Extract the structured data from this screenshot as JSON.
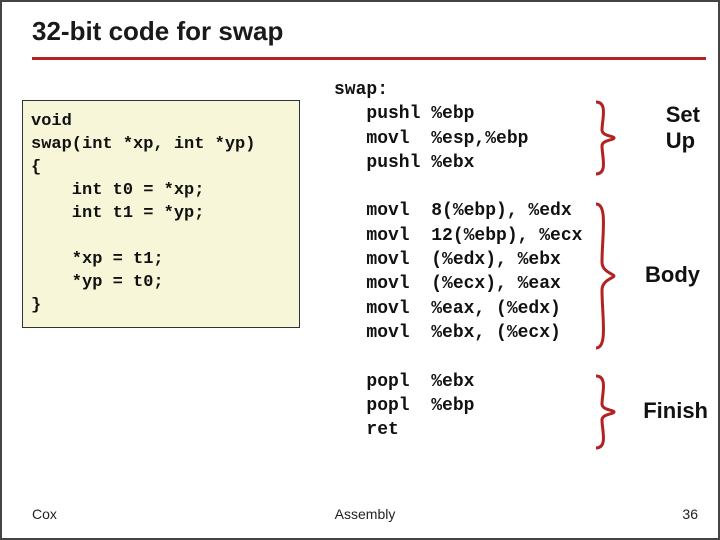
{
  "title": "32-bit code for swap",
  "c_code": "void\nswap(int *xp, int *yp)\n{\n    int t0 = *xp;\n    int t1 = *yp;\n\n    *xp = t1;\n    *yp = t0;\n}",
  "asm_block": "swap:\n   pushl %ebp\n   movl  %esp,%ebp\n   pushl %ebx\n\n   movl  8(%ebp), %edx\n   movl  12(%ebp), %ecx\n   movl  (%edx), %ebx\n   movl  (%ecx), %eax\n   movl  %eax, (%edx)\n   movl  %ebx, (%ecx)\n\n   popl  %ebx\n   popl  %ebp\n   ret",
  "annotations": {
    "setup": "Set\nUp",
    "body": "Body",
    "finish": "Finish"
  },
  "footer": {
    "left": "Cox",
    "center": "Assembly",
    "right": "36"
  },
  "chart_data": {
    "type": "table",
    "title": "32-bit swap: C source vs x86 assembly",
    "sections": [
      {
        "label": "Set Up",
        "instructions": [
          "pushl %ebp",
          "movl %esp,%ebp",
          "pushl %ebx"
        ]
      },
      {
        "label": "Body",
        "instructions": [
          "movl 8(%ebp), %edx",
          "movl 12(%ebp), %ecx",
          "movl (%edx), %ebx",
          "movl (%ecx), %eax",
          "movl %eax, (%edx)",
          "movl %ebx, (%ecx)"
        ]
      },
      {
        "label": "Finish",
        "instructions": [
          "popl %ebx",
          "popl %ebp",
          "ret"
        ]
      }
    ],
    "c_source": "void swap(int *xp, int *yp){int t0=*xp;int t1=*yp;*xp=t1;*yp=t0;}"
  }
}
